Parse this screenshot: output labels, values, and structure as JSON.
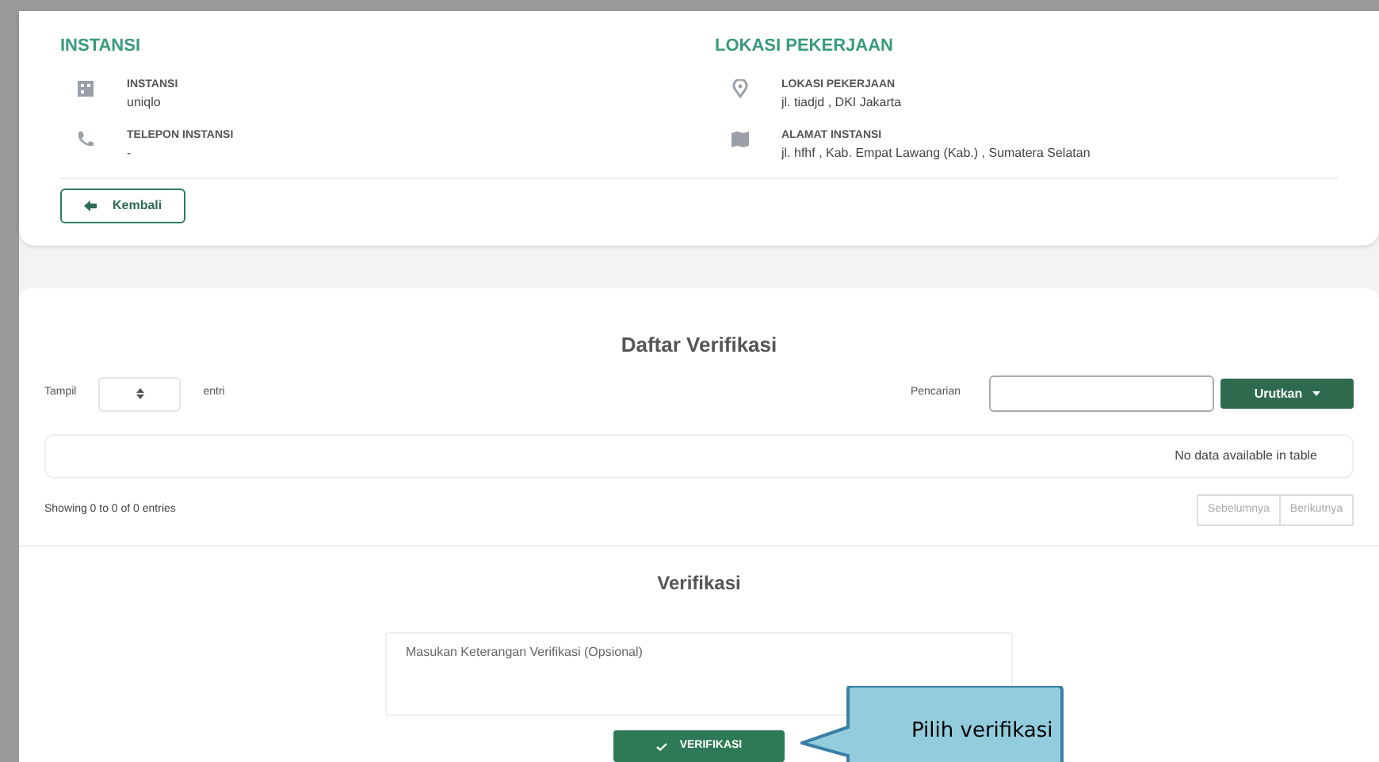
{
  "instansi": {
    "heading": "INSTANSI",
    "items": [
      {
        "kind": "building",
        "label": "INSTANSI",
        "value": "uniqlo"
      },
      {
        "kind": "phone",
        "label": "TELEPON INSTANSI",
        "value": "-"
      }
    ]
  },
  "lokasi": {
    "heading": "LOKASI PEKERJAAN",
    "items": [
      {
        "kind": "pin",
        "label": "LOKASI PEKERJAAN",
        "value": "jl. tiadjd , DKI Jakarta"
      },
      {
        "kind": "map",
        "label": "ALAMAT INSTANSI",
        "value": "jl. hfhf , Kab. Empat Lawang (Kab.) , Sumatera Selatan"
      }
    ]
  },
  "back_button": "Kembali",
  "list": {
    "title": "Daftar Verifikasi",
    "show_label": "Tampil",
    "entries_label": "entri",
    "search_label": "Pencarian",
    "sort_button": "Urutkan",
    "empty_message": "No data available in table",
    "info": "Showing 0 to 0 of 0 entries",
    "prev": "Sebelumnya",
    "next": "Berikutnya"
  },
  "verify": {
    "title": "Verifikasi",
    "placeholder": "Masukan Keterangan Verifikasi (Opsional)",
    "button": "VERIFIKASI"
  },
  "callout": "Pilih verifikasi"
}
